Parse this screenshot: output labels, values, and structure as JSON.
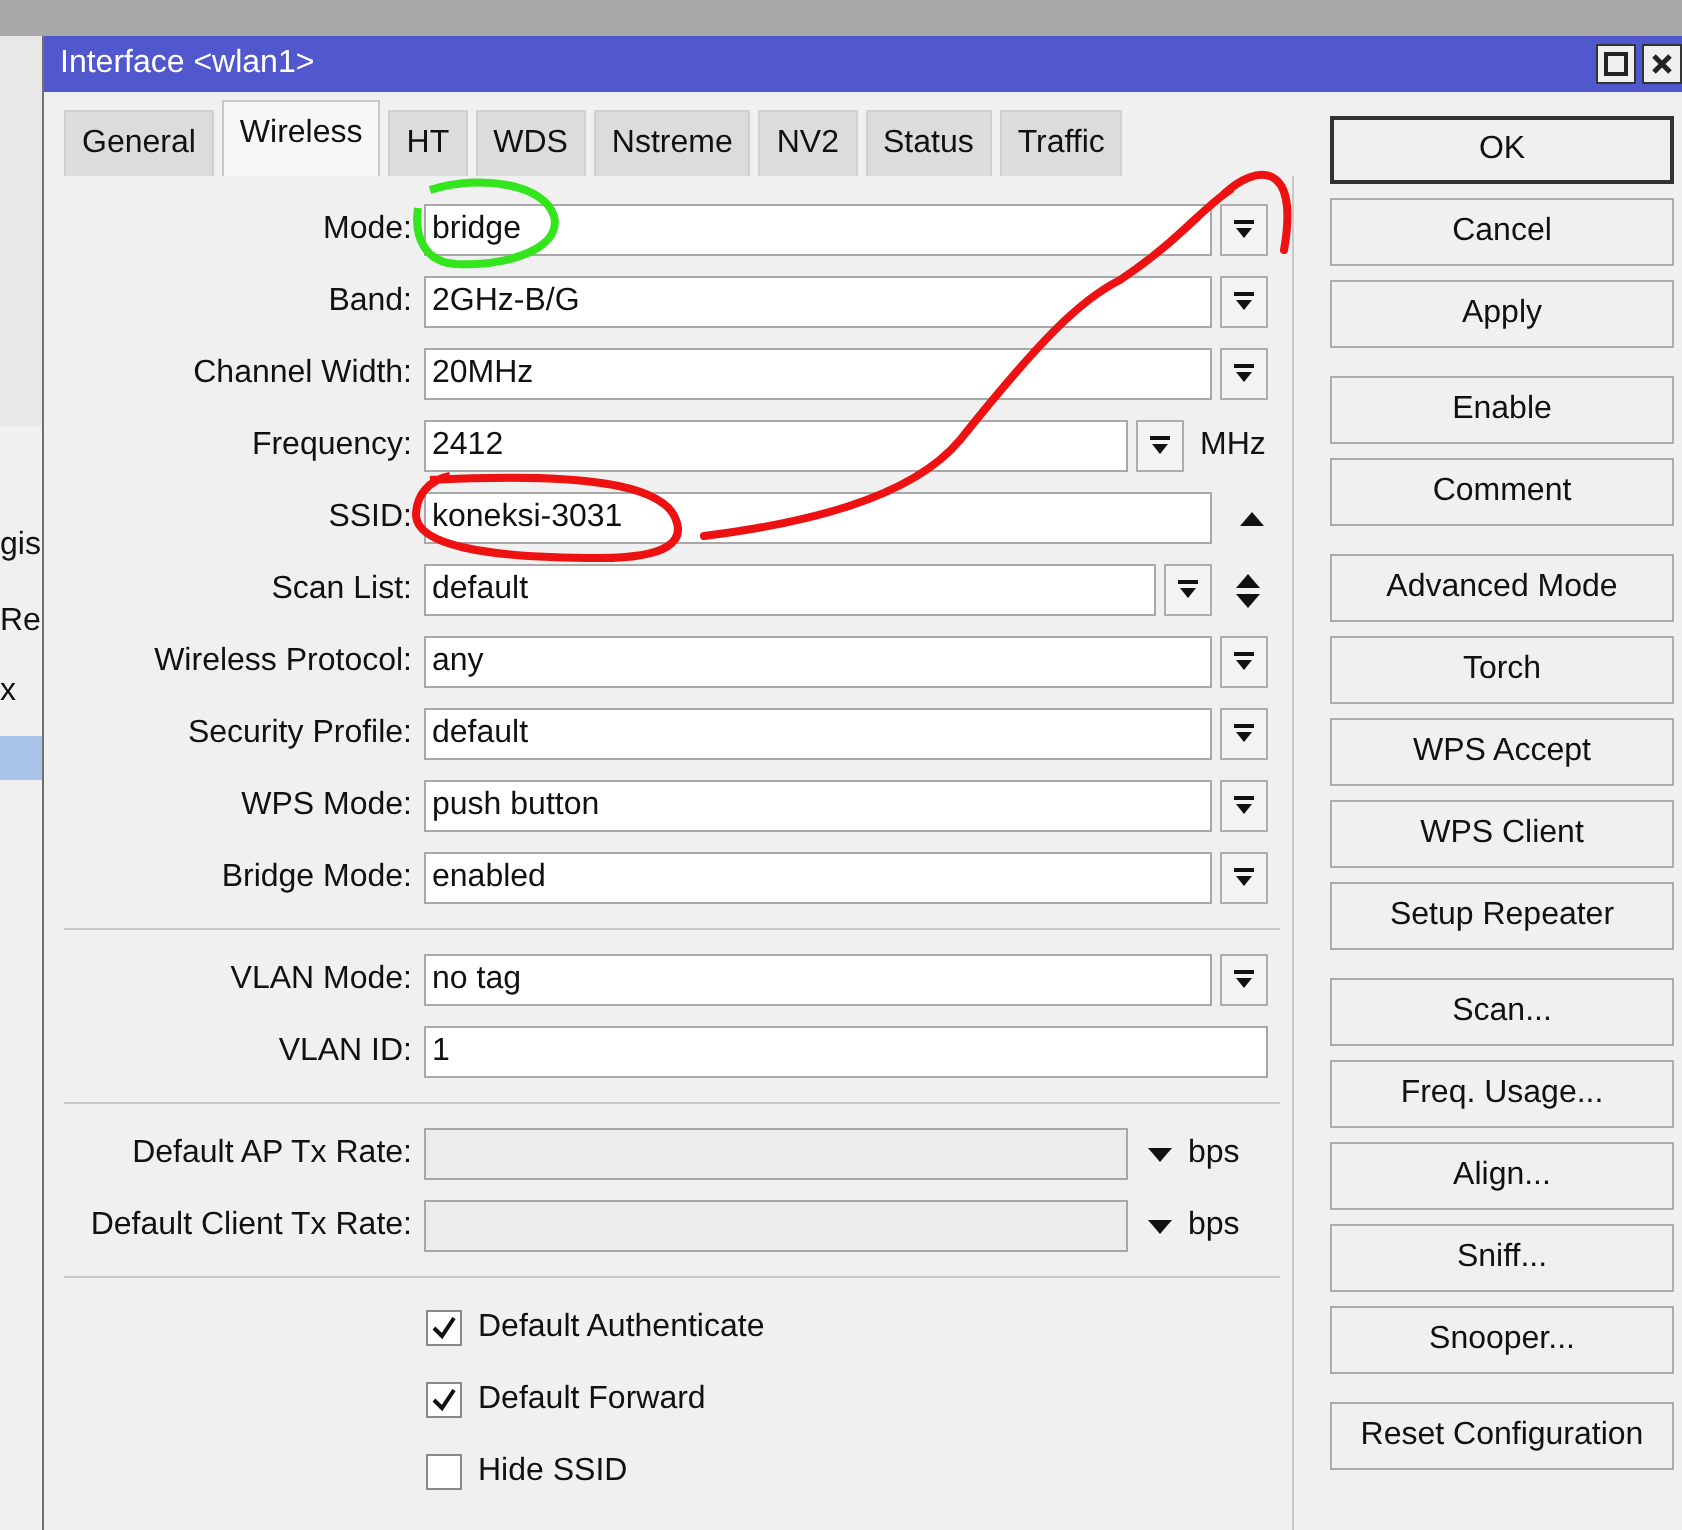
{
  "background": {
    "fragments": [
      "gis",
      "Re",
      "x"
    ]
  },
  "window": {
    "title": "Interface <wlan1>"
  },
  "tabs": [
    {
      "label": "General",
      "selected": false
    },
    {
      "label": "Wireless",
      "selected": true
    },
    {
      "label": "HT",
      "selected": false
    },
    {
      "label": "WDS",
      "selected": false
    },
    {
      "label": "Nstreme",
      "selected": false
    },
    {
      "label": "NV2",
      "selected": false
    },
    {
      "label": "Status",
      "selected": false
    },
    {
      "label": "Traffic",
      "selected": false
    }
  ],
  "sections": [
    [
      {
        "label": "Mode:",
        "kind": "dropdown",
        "value": "bridge"
      },
      {
        "label": "Band:",
        "kind": "dropdown",
        "value": "2GHz-B/G"
      },
      {
        "label": "Channel Width:",
        "kind": "dropdown",
        "value": "20MHz"
      },
      {
        "label": "Frequency:",
        "kind": "dropdown_unit",
        "value": "2412",
        "unit": "MHz"
      },
      {
        "label": "SSID:",
        "kind": "text_arrow",
        "value": "koneksi-3031"
      },
      {
        "label": "Scan List:",
        "kind": "combo_updown",
        "value": "default"
      },
      {
        "label": "Wireless Protocol:",
        "kind": "dropdown",
        "value": "any"
      },
      {
        "label": "Security Profile:",
        "kind": "dropdown",
        "value": "default"
      },
      {
        "label": "WPS Mode:",
        "kind": "dropdown",
        "value": "push button"
      },
      {
        "label": "Bridge Mode:",
        "kind": "dropdown",
        "value": "enabled"
      }
    ],
    [
      {
        "label": "VLAN Mode:",
        "kind": "dropdown",
        "value": "no tag"
      },
      {
        "label": "VLAN ID:",
        "kind": "text",
        "value": "1"
      }
    ],
    [
      {
        "label": "Default AP Tx Rate:",
        "kind": "rate",
        "unit": "bps",
        "disabled": true
      },
      {
        "label": "Default Client Tx Rate:",
        "kind": "rate",
        "unit": "bps",
        "disabled": true
      }
    ]
  ],
  "checkboxes": [
    {
      "label": "Default Authenticate",
      "checked": true
    },
    {
      "label": "Default Forward",
      "checked": true
    },
    {
      "label": "Hide SSID",
      "checked": false
    }
  ],
  "button_groups": [
    [
      {
        "label": "OK",
        "default": true
      },
      {
        "label": "Cancel",
        "default": false
      },
      {
        "label": "Apply",
        "default": false
      }
    ],
    [
      {
        "label": "Enable",
        "default": false
      },
      {
        "label": "Comment",
        "default": false
      }
    ],
    [
      {
        "label": "Advanced Mode",
        "default": false
      },
      {
        "label": "Torch",
        "default": false
      },
      {
        "label": "WPS Accept",
        "default": false
      },
      {
        "label": "WPS Client",
        "default": false
      },
      {
        "label": "Setup Repeater",
        "default": false
      }
    ],
    [
      {
        "label": "Scan...",
        "default": false
      },
      {
        "label": "Freq. Usage...",
        "default": false
      },
      {
        "label": "Align...",
        "default": false
      },
      {
        "label": "Sniff...",
        "default": false
      },
      {
        "label": "Snooper...",
        "default": false
      }
    ],
    [
      {
        "label": "Reset Configuration",
        "default": false
      }
    ]
  ]
}
